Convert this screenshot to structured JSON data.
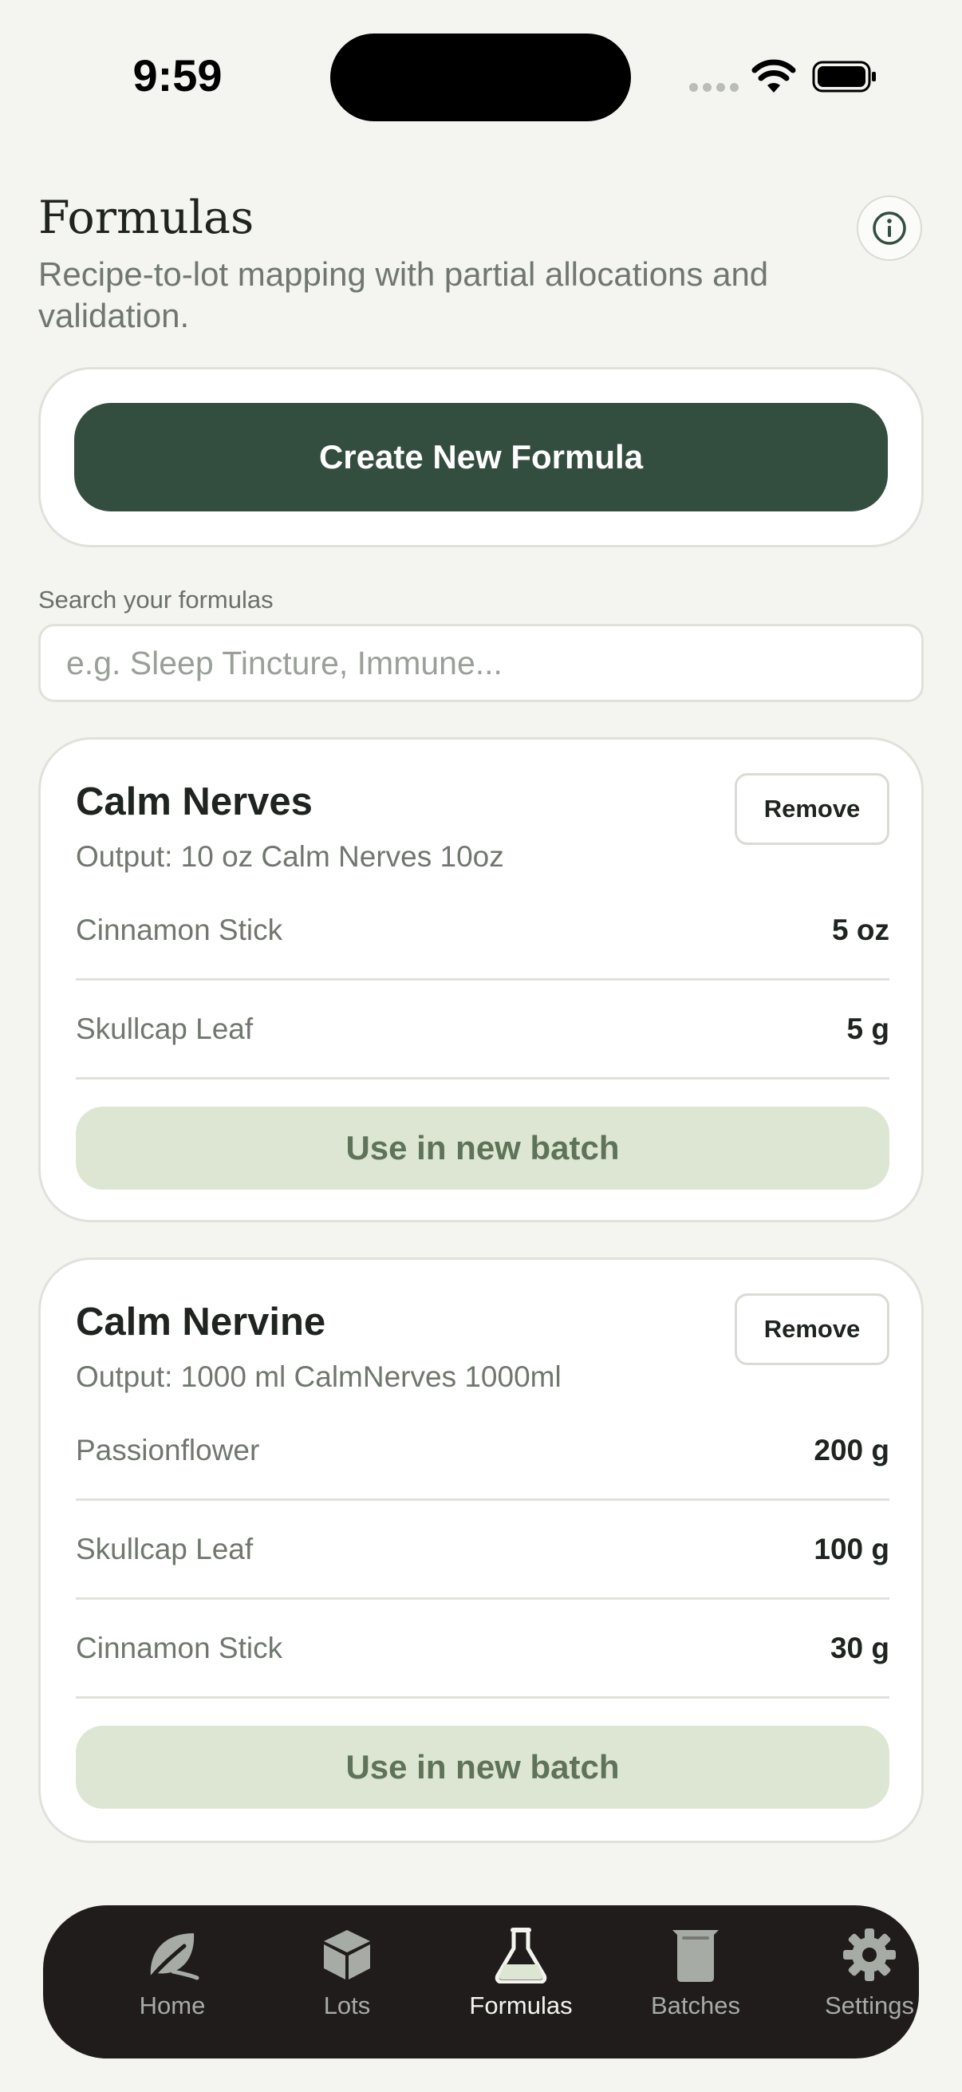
{
  "status_bar": {
    "time": "9:59"
  },
  "header": {
    "title": "Formulas",
    "subtitle": "Recipe-to-lot mapping with partial allocations and validation.",
    "info_icon": "info-icon"
  },
  "create": {
    "button_label": "Create New Formula"
  },
  "search": {
    "label": "Search your formulas",
    "placeholder": "e.g. Sleep Tincture, Immune...",
    "value": ""
  },
  "formulas": [
    {
      "name": "Calm Nerves",
      "output": "Output: 10 oz Calm Nerves 10oz",
      "remove_label": "Remove",
      "ingredients": [
        {
          "name": "Cinnamon Stick",
          "qty": "5 oz"
        },
        {
          "name": "Skullcap Leaf",
          "qty": "5 g"
        }
      ],
      "use_label": "Use in new batch"
    },
    {
      "name": "Calm Nervine",
      "output": "Output: 1000 ml CalmNerves 1000ml",
      "remove_label": "Remove",
      "ingredients": [
        {
          "name": "Passionflower",
          "qty": "200 g"
        },
        {
          "name": "Skullcap Leaf",
          "qty": "100 g"
        },
        {
          "name": "Cinnamon Stick",
          "qty": "30 g"
        }
      ],
      "use_label": "Use in new batch"
    }
  ],
  "tabs": [
    {
      "label": "Home",
      "icon": "leaf-icon",
      "active": false
    },
    {
      "label": "Lots",
      "icon": "box-icon",
      "active": false
    },
    {
      "label": "Formulas",
      "icon": "flask-icon",
      "active": true
    },
    {
      "label": "Batches",
      "icon": "beaker-icon",
      "active": false
    },
    {
      "label": "Settings",
      "icon": "gear-icon",
      "active": false
    }
  ],
  "colors": {
    "background": "#f4f4f0",
    "primary": "#334d3f",
    "secondary_button": "#dde6d2",
    "tab_bar": "#1f1c1b"
  }
}
